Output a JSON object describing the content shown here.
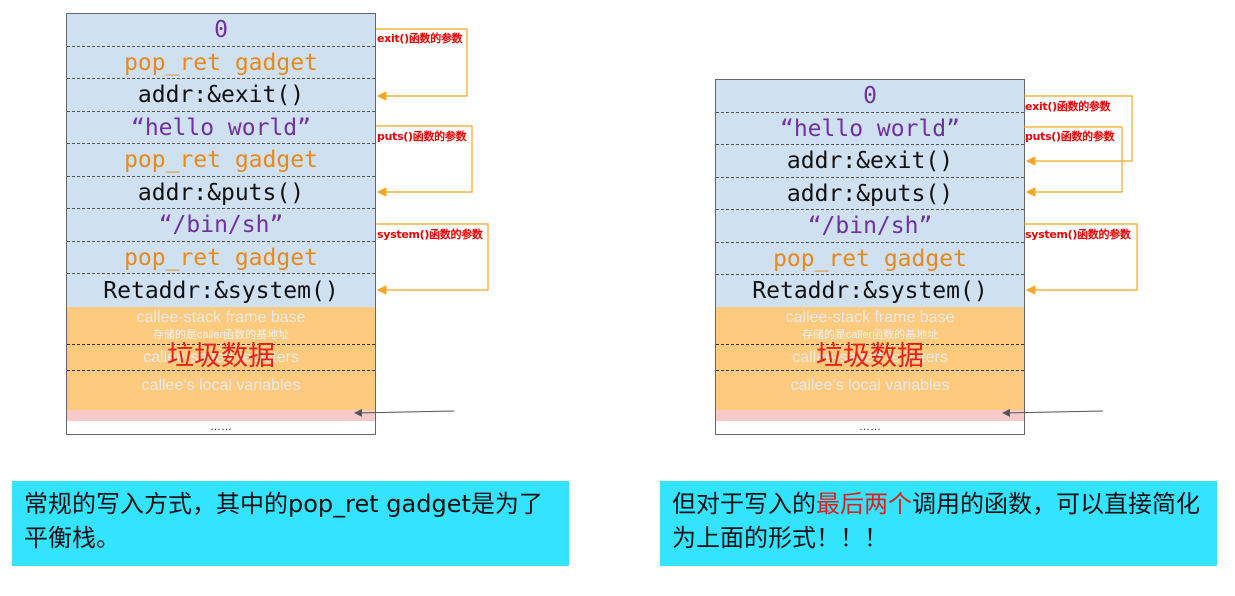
{
  "left_diagram": {
    "cells": [
      {
        "text": "0",
        "kind": "num"
      },
      {
        "text": "pop_ret gadget",
        "kind": "gadget"
      },
      {
        "text": "addr:&exit()",
        "kind": "addr"
      },
      {
        "text": "“hello world”",
        "kind": "str"
      },
      {
        "text": "pop_ret gadget",
        "kind": "gadget"
      },
      {
        "text": "addr:&puts()",
        "kind": "addr"
      },
      {
        "text": "“/bin/sh”",
        "kind": "str"
      },
      {
        "text": "pop_ret gadget",
        "kind": "gadget"
      },
      {
        "text": "Retaddr:&system()",
        "kind": "addr"
      }
    ],
    "annotations": {
      "exit": "exit()函数的参数",
      "puts": "puts()函数的参数",
      "system": "system()函数的参数"
    },
    "frame_base": "callee-stack frame base",
    "frame_base_sub": "存储的是caller函数的基地址",
    "registers": "callee-saved registers",
    "locals": "callee’s local variables",
    "junk": "垃圾数据",
    "dots": "……"
  },
  "right_diagram": {
    "cells": [
      {
        "text": "0",
        "kind": "num"
      },
      {
        "text": "“hello world”",
        "kind": "str"
      },
      {
        "text": "addr:&exit()",
        "kind": "addr"
      },
      {
        "text": "addr:&puts()",
        "kind": "addr"
      },
      {
        "text": "“/bin/sh”",
        "kind": "str"
      },
      {
        "text": "pop_ret gadget",
        "kind": "gadget"
      },
      {
        "text": "Retaddr:&system()",
        "kind": "addr"
      }
    ],
    "annotations": {
      "exit": "exit()函数的参数",
      "puts": "puts()函数的参数",
      "system": "system()函数的参数"
    },
    "frame_base": "callee-stack frame base",
    "frame_base_sub": "存储的是caller函数的基地址",
    "registers": "callee-saved registers",
    "locals": "callee’s local variables",
    "junk": "垃圾数据",
    "dots": "……"
  },
  "captions": {
    "left": "常规的写入方式，其中的pop_ret gadget是为了平衡栈。",
    "right_before": "但对于写入的",
    "right_highlight": "最后两个",
    "right_after": "调用的函数，可以直接简化为上面的形式！！！"
  },
  "colors": {
    "cell_bg": "#cfe0f1",
    "gadget": "#e8891a",
    "string": "#7030a0",
    "frame_bg": "#fdca7e",
    "annotation": "#e00000",
    "arrow": "#f5a623",
    "caption_bg": "#33e3ff"
  }
}
